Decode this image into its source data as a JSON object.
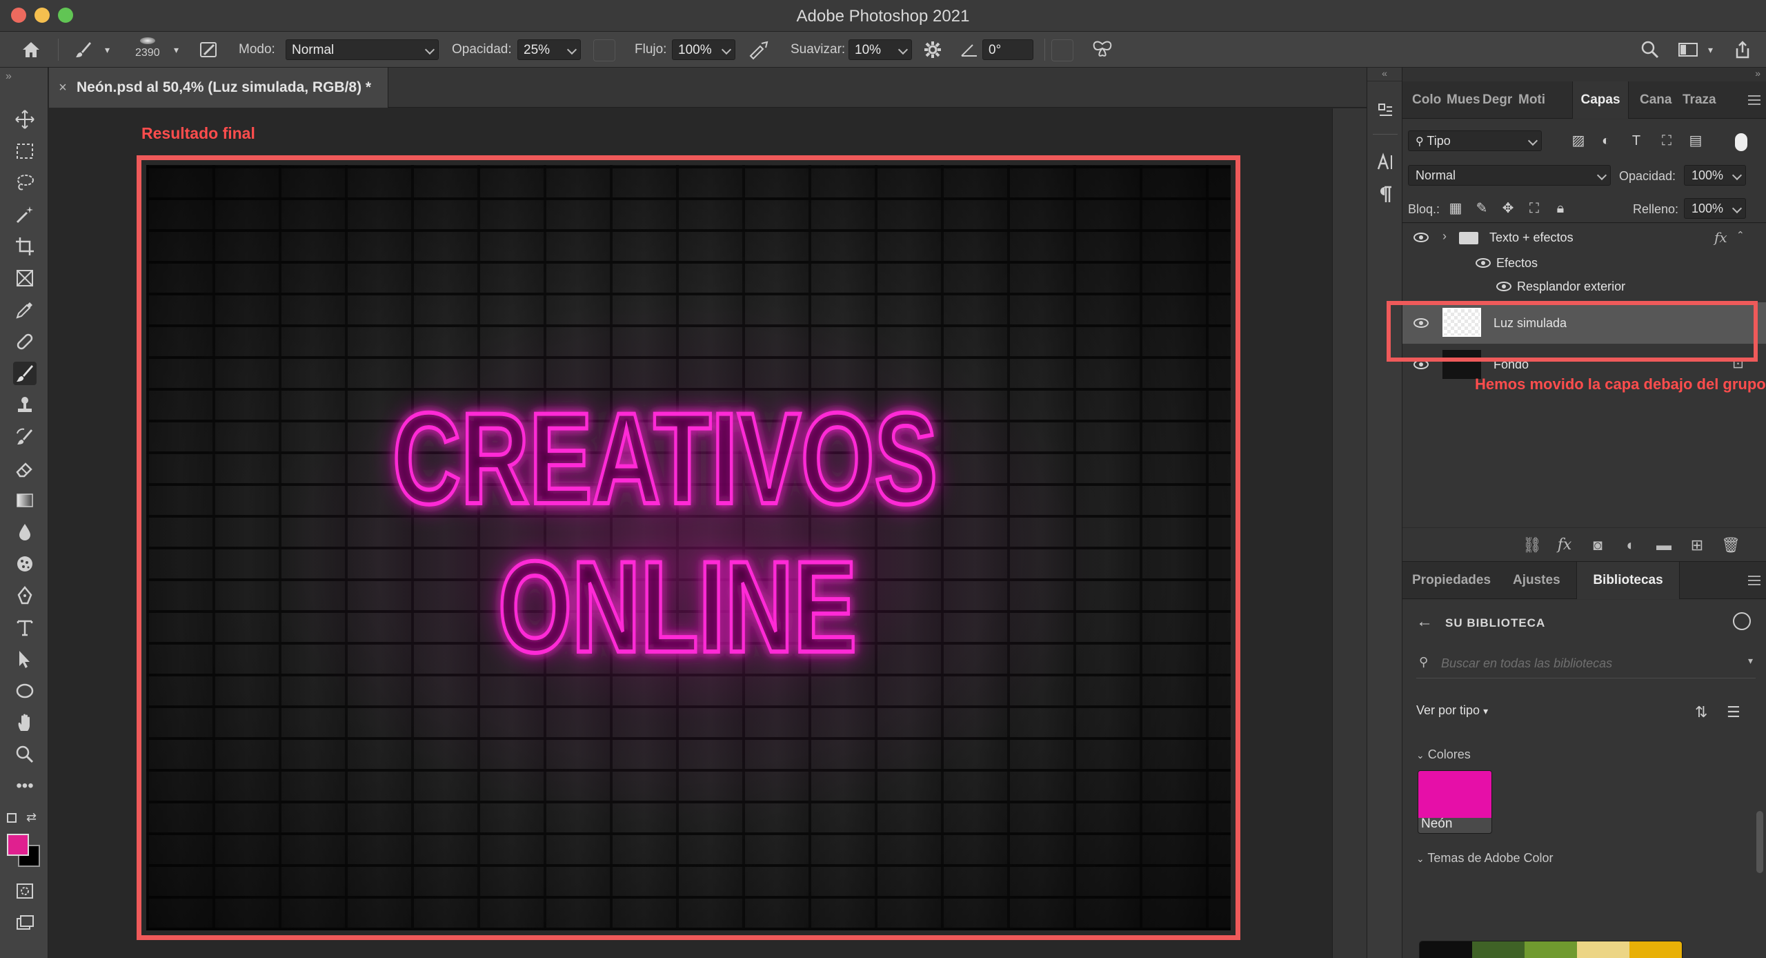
{
  "window": {
    "title": "Adobe Photoshop 2021"
  },
  "options_bar": {
    "brush_size": "2390",
    "mode_label": "Modo:",
    "mode_value": "Normal",
    "opacity_label": "Opacidad:",
    "opacity_value": "25%",
    "flow_label": "Flujo:",
    "flow_value": "100%",
    "smoothing_label": "Suavizar:",
    "smoothing_value": "10%",
    "angle_value": "0°"
  },
  "document": {
    "close_symbol": "×",
    "tab_title": "Neón.psd al 50,4% (Luz simulada, RGB/8) *",
    "canvas_text_line1": "CREATIVOS",
    "canvas_text_line2": "ONLINE",
    "neon_color": "#ff2bd6"
  },
  "annotations": {
    "result_label": "Resultado final",
    "moved_note": "Hemos movido la capa debajo del grupo",
    "highlight_color": "#ef5a5a"
  },
  "layers_panel": {
    "tabs": [
      "Colo",
      "Mues",
      "Degr",
      "Moti",
      "Capas",
      "Cana",
      "Traza"
    ],
    "active_tab": "Capas",
    "filter_value": "Tipo",
    "blend_mode": "Normal",
    "opacity_label": "Opacidad:",
    "opacity_value": "100%",
    "lock_label": "Bloq.:",
    "fill_label": "Relleno:",
    "fill_value": "100%",
    "layers": [
      {
        "name": "Texto + efectos",
        "kind": "group",
        "fx": "fx"
      },
      {
        "name": "Efectos",
        "kind": "effects-header"
      },
      {
        "name": "Resplandor exterior",
        "kind": "effect"
      },
      {
        "name": "Luz simulada",
        "kind": "layer",
        "selected": true
      },
      {
        "name": "Fondo",
        "kind": "background",
        "locked": true
      }
    ]
  },
  "lower_panel": {
    "tabs": [
      "Propiedades",
      "Ajustes",
      "Bibliotecas"
    ],
    "active_tab": "Bibliotecas",
    "library_title": "SU BIBLIOTECA",
    "search_placeholder": "Buscar en todas las bibliotecas",
    "view_by": "Ver por tipo",
    "colors_section": "Colores",
    "swatch_label": "Neón",
    "swatch_color": "#e60fa8",
    "themes_section": "Temas de Adobe Color",
    "theme_colors": [
      "#0e0e0e",
      "#3f6226",
      "#709a2f",
      "#ecd585",
      "#e8b007"
    ]
  },
  "colors": {
    "foreground": "#e0208f",
    "background": "#000000"
  }
}
